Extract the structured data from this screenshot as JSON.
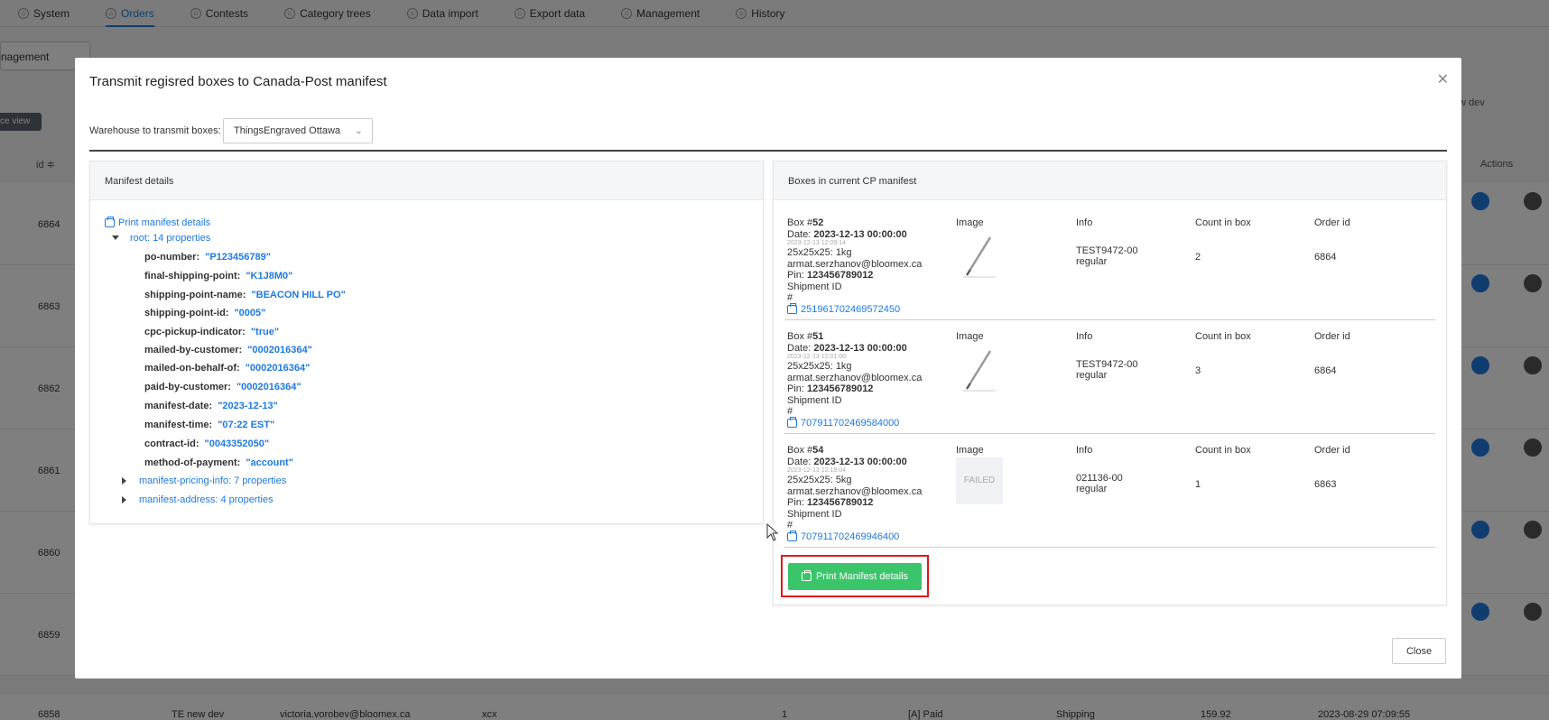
{
  "topnav": {
    "tabs": [
      {
        "label": "System"
      },
      {
        "label": "Orders"
      },
      {
        "label": "Contests"
      },
      {
        "label": "Category trees"
      },
      {
        "label": "Data import"
      },
      {
        "label": "Export data"
      },
      {
        "label": "Management"
      },
      {
        "label": "History"
      }
    ]
  },
  "background": {
    "select_value": "nagement",
    "view_button": "ce view",
    "id_header": "id ≑",
    "actions_header": "Actions",
    "dev_label": "w dev",
    "row_ids": [
      "6864",
      "6863",
      "6862",
      "6861",
      "6860",
      "6859"
    ],
    "bottom_row": {
      "id": "6858",
      "name": "TE new dev",
      "email": "victoria.vorobev@bloomex.ca",
      "code": "xcx",
      "badge": "1",
      "status": "[A] Paid",
      "shipping": "Shipping",
      "amount": "159.92",
      "date": "2023-08-29 07:09:55"
    }
  },
  "modal": {
    "title": "Transmit regisred boxes to Canada-Post manifest",
    "warehouse_label": "Warehouse to transmit boxes:",
    "warehouse_value": "ThingsEngraved Ottawa",
    "left_panel": {
      "header": "Manifest details",
      "print_link": "Print manifest details",
      "root_key": "root:",
      "root_count": "14 properties",
      "properties": [
        {
          "key": "po-number:",
          "value": "\"P123456789\""
        },
        {
          "key": "final-shipping-point:",
          "value": "\"K1J8M0\""
        },
        {
          "key": "shipping-point-name:",
          "value": "\"BEACON HILL PO\""
        },
        {
          "key": "shipping-point-id:",
          "value": "\"0005\""
        },
        {
          "key": "cpc-pickup-indicator:",
          "value": "\"true\""
        },
        {
          "key": "mailed-by-customer:",
          "value": "\"0002016364\""
        },
        {
          "key": "mailed-on-behalf-of:",
          "value": "\"0002016364\""
        },
        {
          "key": "paid-by-customer:",
          "value": "\"0002016364\""
        },
        {
          "key": "manifest-date:",
          "value": "\"2023-12-13\""
        },
        {
          "key": "manifest-time:",
          "value": "\"07:22 EST\""
        },
        {
          "key": "contract-id:",
          "value": "\"0043352050\""
        },
        {
          "key": "method-of-payment:",
          "value": "\"account\""
        }
      ],
      "collapsed": [
        {
          "key": "manifest-pricing-info:",
          "count": "7 properties"
        },
        {
          "key": "manifest-address:",
          "count": "4 properties"
        }
      ]
    },
    "right_panel": {
      "header": "Boxes in current CP manifest",
      "columns": {
        "image": "Image",
        "info": "Info",
        "count": "Count in box",
        "order": "Order id"
      },
      "boxes": [
        {
          "box_label": "Box #",
          "box_no": "52",
          "date_label": "Date: ",
          "date": "2023-12-13 00:00:00",
          "tiny": "2023-12-13 12:09:14",
          "dims": "25x25x25: 1kg",
          "email": "armat.serzhanov@bloomex.ca",
          "pin_label": "Pin: ",
          "pin": "123456789012",
          "shipment_label": "Shipment ID",
          "hash": "#",
          "tracking": "251961702469572450",
          "image_state": "pen",
          "info_line1": "TEST9472-00",
          "info_line2": "regular",
          "count": "2",
          "order_id": "6864"
        },
        {
          "box_label": "Box #",
          "box_no": "51",
          "date_label": "Date: ",
          "date": "2023-12-13 00:00:00",
          "tiny": "2023-12-13 12:01:00",
          "dims": "25x25x25: 1kg",
          "email": "armat.serzhanov@bloomex.ca",
          "pin_label": "Pin: ",
          "pin": "123456789012",
          "shipment_label": "Shipment ID",
          "hash": "#",
          "tracking": "707911702469584000",
          "image_state": "pen",
          "info_line1": "TEST9472-00",
          "info_line2": "regular",
          "count": "3",
          "order_id": "6864"
        },
        {
          "box_label": "Box #",
          "box_no": "54",
          "date_label": "Date: ",
          "date": "2023-12-13 00:00:00",
          "tiny": "2023-12-13 12:19:04",
          "dims": "25x25x25: 5kg",
          "email": "armat.serzhanov@bloomex.ca",
          "pin_label": "Pin: ",
          "pin": "123456789012",
          "shipment_label": "Shipment ID",
          "hash": "#",
          "tracking": "707911702469946400",
          "image_state": "FAILED",
          "info_line1": "021136-00",
          "info_line2": "regular",
          "count": "1",
          "order_id": "6863"
        }
      ],
      "print_button": "Print Manifest details"
    },
    "close_button": "Close"
  },
  "colors": {
    "accent": "#1f7ae0",
    "success": "#3bc56b",
    "highlight": "#e01919"
  }
}
